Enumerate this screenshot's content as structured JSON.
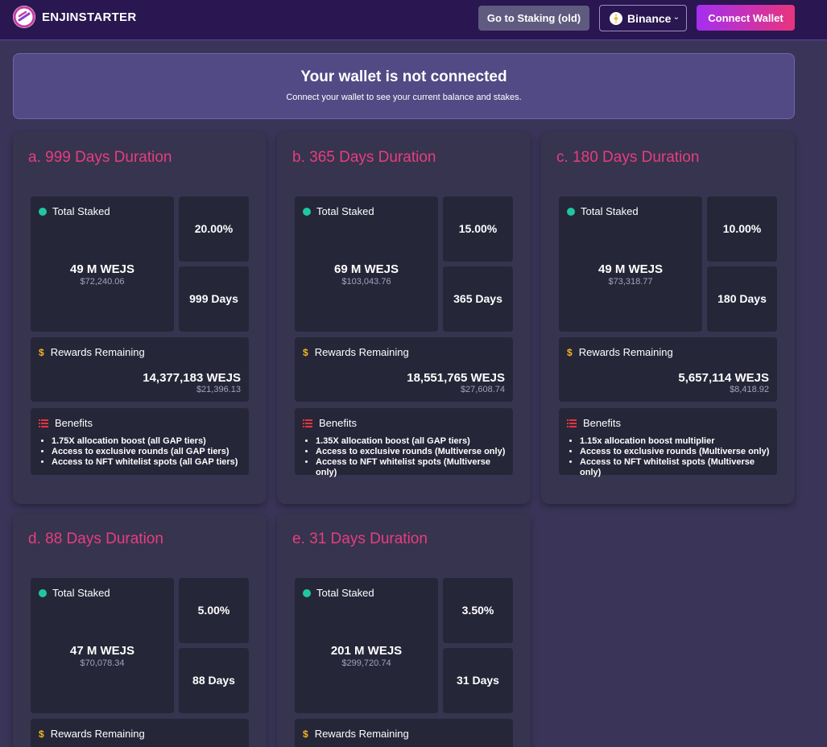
{
  "app": {
    "name": "ENJINSTARTER",
    "colors": {
      "accent": "#e83d7d",
      "header": "#2a1651",
      "card": "#36344f",
      "box": "#262639",
      "staked_dot": "#1fc7a0",
      "dollar": "#f3b61f"
    }
  },
  "header": {
    "staking_button": "Go to Staking (old)",
    "network": "Binance",
    "network_icon": "binance-icon",
    "connect_button": "Connect Wallet"
  },
  "wallet": {
    "title": "Your wallet is not connected",
    "subtitle": "Connect your wallet to see your current balance and stakes."
  },
  "labels": {
    "total_staked": "Total Staked",
    "rewards_remaining": "Rewards Remaining",
    "benefits": "Benefits",
    "dollar_icon": "$"
  },
  "pools": [
    {
      "title": "a. 999 Days Duration",
      "staked": "49 M WEJS",
      "staked_usd": "$72,240.06",
      "apy": "20.00%",
      "days": "999 Days",
      "rewards": "14,377,183 WEJS",
      "rewards_usd": "$21,396.13",
      "benefits": [
        "1.75X allocation boost (all GAP tiers)",
        "Access to exclusive rounds (all GAP tiers)",
        "Access to NFT whitelist spots (all GAP tiers)"
      ]
    },
    {
      "title": "b. 365 Days Duration",
      "staked": "69 M WEJS",
      "staked_usd": "$103,043.76",
      "apy": "15.00%",
      "days": "365 Days",
      "rewards": "18,551,765 WEJS",
      "rewards_usd": "$27,608.74",
      "benefits": [
        "1.35X allocation boost (all GAP tiers)",
        "Access to exclusive rounds (Multiverse only)",
        "Access to NFT whitelist spots (Multiverse only)"
      ]
    },
    {
      "title": "c. 180 Days Duration",
      "staked": "49 M WEJS",
      "staked_usd": "$73,318.77",
      "apy": "10.00%",
      "days": "180 Days",
      "rewards": "5,657,114 WEJS",
      "rewards_usd": "$8,418.92",
      "benefits": [
        "1.15x allocation boost multiplier",
        "Access to exclusive rounds (Multiverse only)",
        "Access to NFT whitelist spots (Multiverse only)"
      ]
    },
    {
      "title": "d. 88 Days Duration",
      "staked": "47 M WEJS",
      "staked_usd": "$70,078.34",
      "apy": "5.00%",
      "days": "88 Days"
    },
    {
      "title": "e. 31 Days Duration",
      "staked": "201 M WEJS",
      "staked_usd": "$299,720.74",
      "apy": "3.50%",
      "days": "31 Days"
    }
  ]
}
